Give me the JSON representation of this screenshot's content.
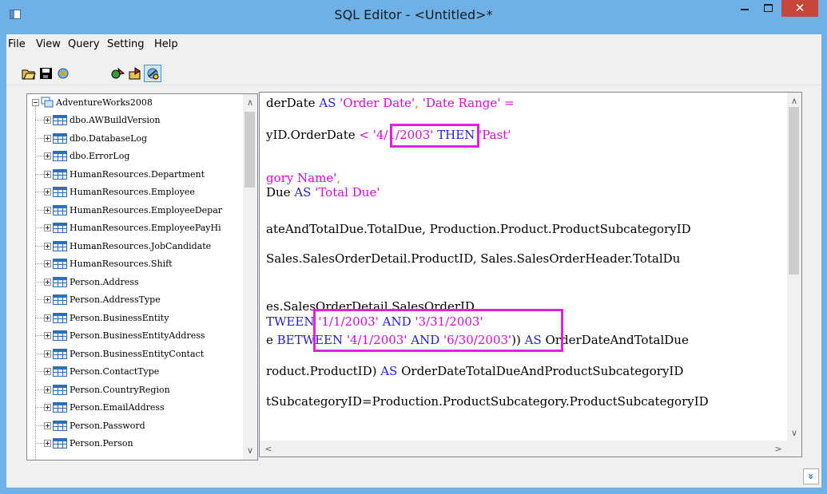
{
  "window": {
    "title": "SQL Editor - <Untitled>*",
    "close_glyph": "✕",
    "colors": {
      "frame": "#6fb1e6",
      "close": "#c7463a",
      "highlight": "#e41ee4"
    }
  },
  "menu": [
    "File",
    "View",
    "Query",
    "Setting",
    "Help"
  ],
  "toolbar": {
    "icons": [
      "open-folder-icon",
      "save-icon",
      "refresh-icon",
      "execute-icon",
      "import-icon",
      "connect-icon"
    ]
  },
  "tree": {
    "root": "AdventureWorks2008",
    "items": [
      "dbo.AWBuildVersion",
      "dbo.DatabaseLog",
      "dbo.ErrorLog",
      "HumanResources.Department",
      "HumanResources.Employee",
      "HumanResources.EmployeeDepar",
      "HumanResources.EmployeePayHi",
      "HumanResources.JobCandidate",
      "HumanResources.Shift",
      "Person.Address",
      "Person.AddressType",
      "Person.BusinessEntity",
      "Person.BusinessEntityAddress",
      "Person.BusinessEntityContact",
      "Person.ContactType",
      "Person.CountryRegion",
      "Person.EmailAddress",
      "Person.Password",
      "Person.Person"
    ]
  },
  "editor": {
    "line1": {
      "a": "derDate ",
      "kw": "AS",
      "s1": " 'Order Date'",
      "c": ", ",
      "s2": "'Date Range'",
      "eq": " ="
    },
    "line2": {
      "a": "yID.OrderDate ",
      "lt": "<",
      "s": " '4/1/2003'",
      "kw": " THEN",
      "s2": " 'Past'"
    },
    "line3": {
      "s": "gory Name'",
      "c": ","
    },
    "line4": {
      "a": "Due ",
      "kw": "AS",
      "s": " 'Total Due'"
    },
    "line5": {
      "a": "ateAndTotalDue.TotalDue, ",
      "b": "Production.Product.ProductSubcategoryID"
    },
    "line6": {
      "a": "Sales.SalesOrderDetail.ProductID, ",
      "b": "Sales.SalesOrderHeader.TotalDu"
    },
    "line7": {
      "a": "es.SalesOrderDetail.SalesOrderID"
    },
    "line8": {
      "kw": "TWEEN",
      "s1": " '1/1/2003'",
      "and": " AND",
      "s2": " '3/31/2003'"
    },
    "line9": {
      "a": "e ",
      "kw": "BETWEEN",
      "s1": " '4/1/2003'",
      "and": " AND",
      "s2": " '6/30/2003'",
      "p": "))",
      "kw2": " AS",
      "b": " OrderDateAndTotalDue"
    },
    "line10": {
      "a": "roduct.ProductID) ",
      "kw": "AS",
      "b": " OrderDateTotalDueAndProductSubcategoryID"
    },
    "line11": {
      "a": "tSubcategoryID=Production.ProductSubcategory.ProductSubcategoryID"
    }
  },
  "status": {
    "expand_glyph": "»"
  }
}
